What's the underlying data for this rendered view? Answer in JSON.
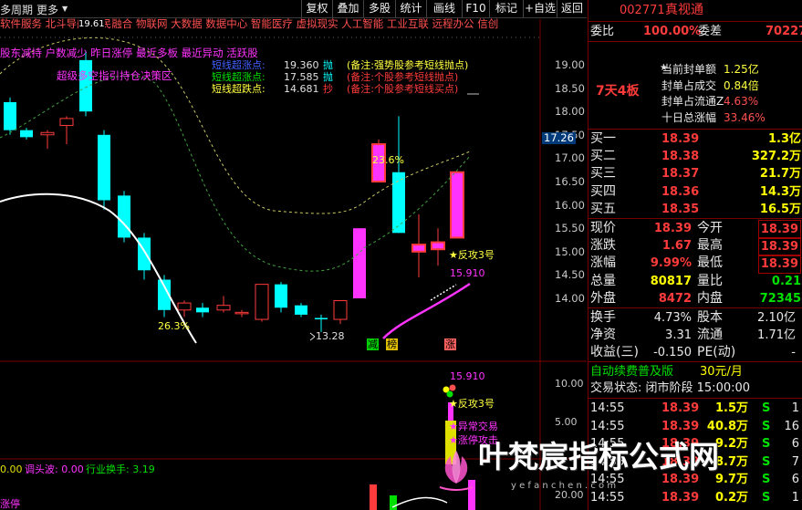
{
  "toolbar": {
    "period_label": "多周期",
    "more_label": "更多",
    "buttons": [
      "复权",
      "叠加",
      "多股",
      "统计",
      "画线",
      "F10",
      "标记",
      "+自选",
      "返回"
    ]
  },
  "chart": {
    "price_axis": [
      "19.00",
      "18.50",
      "18.00",
      "17.50",
      "17.00",
      "16.50",
      "16.00",
      "15.50",
      "15.00",
      "14.50",
      "14.00"
    ],
    "price_axis_highlight": "17.26",
    "volume_axis": [
      "10.00",
      "5.00"
    ],
    "bottom_axis": [
      "20.00"
    ],
    "top_small_value": "19.61",
    "concept_line1": "软件服务 北斗导航 军民融合 物联网 大数据 数据中心 智能医疗 虚拟现实 人工智能 工业互联 远程办公 信创",
    "concept_line2": "股东减持 户数减少 昨日涨停 最近多板 最近异动 活跃股",
    "indicator_title": "超级多空指引持仓决策区",
    "signals": [
      {
        "name": "短线超涨点:",
        "value": "19.360",
        "tag": "抛",
        "note": "(备注:强势股参考短线抛点)"
      },
      {
        "name": "短线超涨点:",
        "value": "17.585",
        "tag": "抛",
        "note": "(备注:个股参考短线抛点)"
      },
      {
        "name": "短线超跌点:",
        "value": "14.681",
        "tag": "抄",
        "note": "(备注:个股参考短线买点)"
      }
    ],
    "annotations": {
      "pct_up": "23.6%",
      "pct_low": "26.3%",
      "low_price": "13.28",
      "fangong_upper": "★反攻3号",
      "upper_value": "15.910",
      "lower_value": "15.910",
      "fangong_lower": "★反攻3号",
      "abnormal": "★异常交易",
      "limit_up": "★涨停攻击",
      "tag_jian": "减",
      "tag_bang": "榜",
      "tag_zhang": "涨"
    },
    "bottom_indicator": {
      "v1": "0.00",
      "v2_label": "调头波: 0.00",
      "v3_label": "行业换手: 3.19"
    },
    "bottom_text": "涨停"
  },
  "panel": {
    "code": "002771",
    "name": "真视通",
    "wei_bi_label": "委比",
    "wei_bi_value": "100.00%",
    "wei_cha_label": "委差",
    "wei_cha_value": "70227",
    "board_label": "7天4板",
    "seal_stats": [
      {
        "label": "当前封单额",
        "value": "1.25亿"
      },
      {
        "label": "封单占成交",
        "value": "0.84倍"
      },
      {
        "label": "封单占流通Z",
        "value": "4.63%"
      },
      {
        "label": "十日总涨幅",
        "value": "33.46%"
      }
    ],
    "bids": [
      {
        "label": "买一",
        "price": "18.39",
        "vol": "1.3亿"
      },
      {
        "label": "买二",
        "price": "18.38",
        "vol": "327.2万"
      },
      {
        "label": "买三",
        "price": "18.37",
        "vol": "21.7万"
      },
      {
        "label": "买四",
        "price": "18.36",
        "vol": "14.3万"
      },
      {
        "label": "买五",
        "price": "18.35",
        "vol": "16.5万"
      }
    ],
    "quote": [
      {
        "l1": "现价",
        "v1": "18.39",
        "l2": "今开",
        "v2": "18.39"
      },
      {
        "l1": "涨跌",
        "v1": "1.67",
        "l2": "最高",
        "v2": "18.39"
      },
      {
        "l1": "涨幅",
        "v1": "9.99%",
        "l2": "最低",
        "v2": "18.39"
      },
      {
        "l1": "总量",
        "v1": "80817",
        "l2": "量比",
        "v2": "0.21"
      },
      {
        "l1": "外盘",
        "v1": "8472",
        "l2": "内盘",
        "v2": "72345"
      }
    ],
    "stats": [
      {
        "l1": "换手",
        "v1": "4.73%",
        "l2": "股本",
        "v2": "2.10亿"
      },
      {
        "l1": "净资",
        "v1": "3.31",
        "l2": "流通",
        "v2": "1.71亿"
      },
      {
        "l1": "收益(三)",
        "v1": "-0.150",
        "l2": "PE(动)",
        "v2": "-"
      }
    ],
    "banner": {
      "text": "自动续费普及版",
      "price": "30元/月"
    },
    "trade_state": "交易状态: 闭市阶段 15:00:00",
    "ticks": [
      {
        "time": "14:55",
        "price": "18.39",
        "vol": "1.5万",
        "side": "S",
        "n": "1"
      },
      {
        "time": "14:55",
        "price": "18.39",
        "vol": "40.8万",
        "side": "S",
        "n": "16"
      },
      {
        "time": "14:55",
        "price": "18.39",
        "vol": "9.2万",
        "side": "S",
        "n": "6"
      },
      {
        "time": "14:55",
        "price": "18.39",
        "vol": "8.7万",
        "side": "S",
        "n": "7"
      },
      {
        "time": "14:55",
        "price": "18.39",
        "vol": "9.7万",
        "side": "S",
        "n": "6"
      },
      {
        "time": "14:55",
        "price": "18.39",
        "vol": "0.2万",
        "side": "S",
        "n": "1"
      }
    ]
  },
  "watermark": {
    "text": "叶梵宸指标公式网",
    "url": "y e f a n c h e n . c o m"
  },
  "colors": {
    "up": "#ff3b3b",
    "down": "#00ffff",
    "limit": "#ff33ff",
    "panel_border": "#7a0000"
  }
}
